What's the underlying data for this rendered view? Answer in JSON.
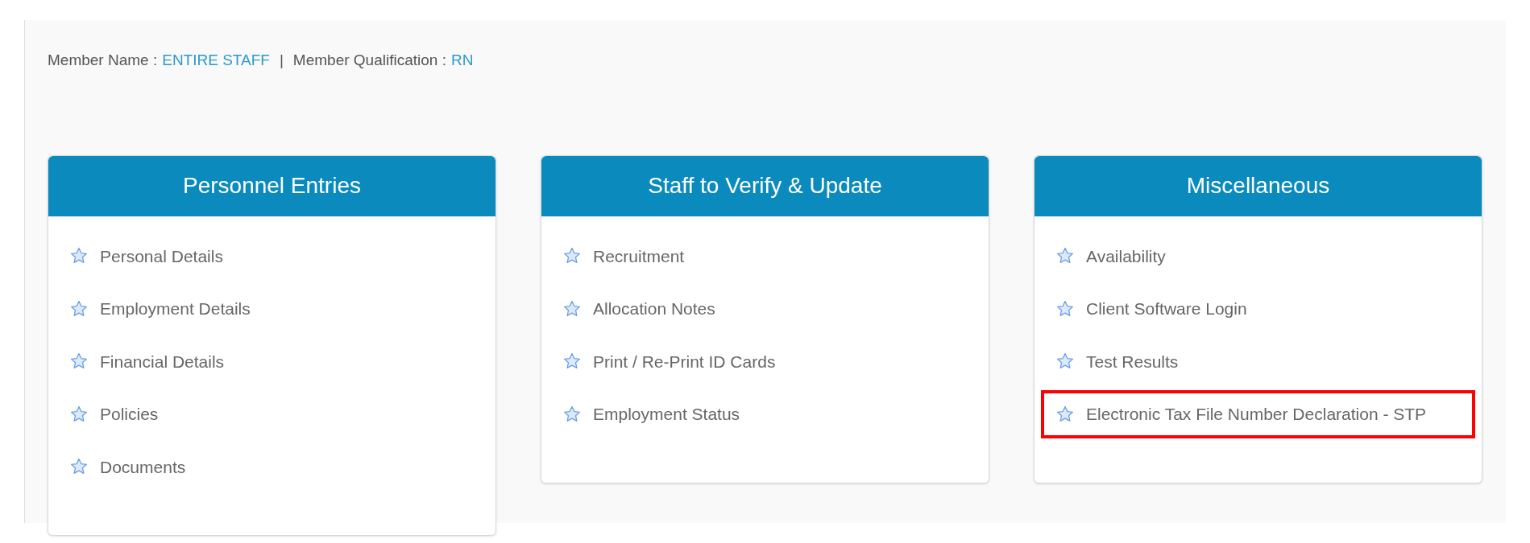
{
  "member_info": {
    "name_label": "Member Name :",
    "name_value": "ENTIRE STAFF",
    "separator": "|",
    "qualification_label": "Member Qualification :",
    "qualification_value": "RN"
  },
  "panels": [
    {
      "title": "Personnel Entries",
      "items": [
        {
          "label": "Personal Details",
          "highlighted": false
        },
        {
          "label": "Employment Details",
          "highlighted": false
        },
        {
          "label": "Financial Details",
          "highlighted": false
        },
        {
          "label": "Policies",
          "highlighted": false
        },
        {
          "label": "Documents",
          "highlighted": false
        }
      ]
    },
    {
      "title": "Staff to Verify & Update",
      "items": [
        {
          "label": "Recruitment",
          "highlighted": false
        },
        {
          "label": "Allocation Notes",
          "highlighted": false
        },
        {
          "label": "Print / Re-Print ID Cards",
          "highlighted": false
        },
        {
          "label": "Employment Status",
          "highlighted": false
        }
      ]
    },
    {
      "title": "Miscellaneous",
      "items": [
        {
          "label": "Availability",
          "highlighted": false
        },
        {
          "label": "Client Software Login",
          "highlighted": false
        },
        {
          "label": "Test Results",
          "highlighted": false
        },
        {
          "label": "Electronic Tax File Number Declaration - STP",
          "highlighted": true
        }
      ]
    }
  ]
}
